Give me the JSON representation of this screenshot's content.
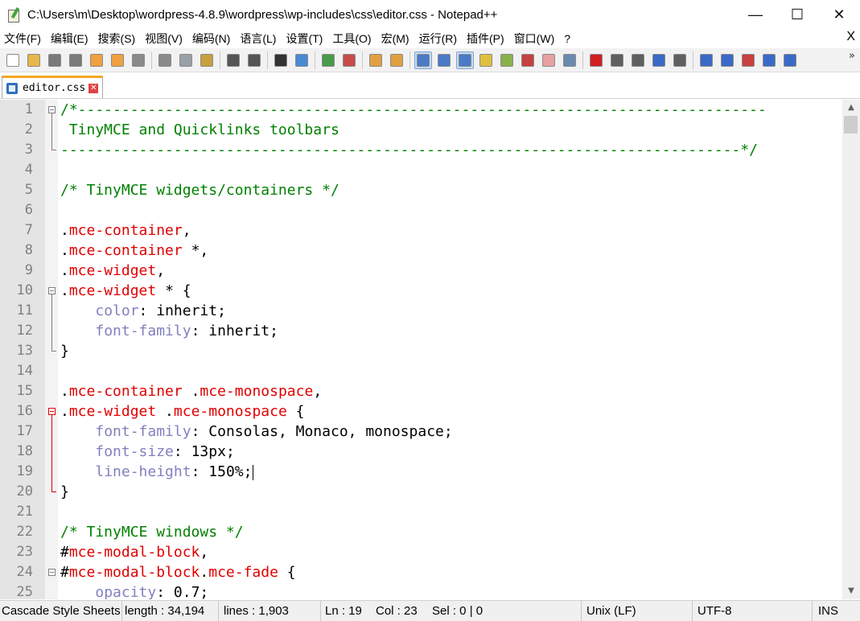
{
  "window": {
    "title": "C:\\Users\\m\\Desktop\\wordpress-4.8.9\\wordpress\\wp-includes\\css\\editor.css - Notepad++",
    "minimize": "—",
    "maximize": "☐",
    "close": "✕"
  },
  "menu": {
    "items": [
      "文件(F)",
      "编辑(E)",
      "搜索(S)",
      "视图(V)",
      "编码(N)",
      "语言(L)",
      "设置(T)",
      "工具(O)",
      "宏(M)",
      "运行(R)",
      "插件(P)",
      "窗口(W)",
      "?"
    ],
    "close": "X"
  },
  "toolbar": {
    "buttons": [
      {
        "name": "new-file-icon",
        "color": "#ffffff"
      },
      {
        "name": "open-file-icon",
        "color": "#e8b64a"
      },
      {
        "name": "save-icon",
        "color": "#7a7a7a"
      },
      {
        "name": "save-all-icon",
        "color": "#7a7a7a"
      },
      {
        "name": "close-file-icon",
        "color": "#f0a040"
      },
      {
        "name": "close-all-icon",
        "color": "#f0a040"
      },
      {
        "name": "print-icon",
        "color": "#8a8a8a"
      },
      {
        "name": "sep"
      },
      {
        "name": "cut-icon",
        "color": "#8a8a8a"
      },
      {
        "name": "copy-icon",
        "color": "#9aa0a8"
      },
      {
        "name": "paste-icon",
        "color": "#c8a040"
      },
      {
        "name": "sep"
      },
      {
        "name": "undo-icon",
        "color": "#555555"
      },
      {
        "name": "redo-icon",
        "color": "#555555"
      },
      {
        "name": "sep"
      },
      {
        "name": "find-icon",
        "color": "#333333"
      },
      {
        "name": "replace-icon",
        "color": "#4a8ad4"
      },
      {
        "name": "sep"
      },
      {
        "name": "zoom-in-icon",
        "color": "#4a9a4a"
      },
      {
        "name": "zoom-out-icon",
        "color": "#c84a4a"
      },
      {
        "name": "sep"
      },
      {
        "name": "sync-vertical-icon",
        "color": "#e0a040"
      },
      {
        "name": "sync-horizontal-icon",
        "color": "#e0a040"
      },
      {
        "name": "sep"
      },
      {
        "name": "word-wrap-icon",
        "color": "#4a7ac8",
        "active": true
      },
      {
        "name": "show-all-chars-icon",
        "color": "#4a7ac8"
      },
      {
        "name": "indent-guide-icon",
        "color": "#4a7ac8",
        "active": true
      },
      {
        "name": "user-language-icon",
        "color": "#e0c040"
      },
      {
        "name": "document-map-icon",
        "color": "#8ab04a"
      },
      {
        "name": "function-list-icon",
        "color": "#c84040"
      },
      {
        "name": "folder-workspace-icon",
        "color": "#e8a0a0"
      },
      {
        "name": "monitor-icon",
        "color": "#6a8ab0"
      },
      {
        "name": "sep"
      },
      {
        "name": "record-macro-icon",
        "color": "#d02020"
      },
      {
        "name": "stop-macro-icon",
        "color": "#606060"
      },
      {
        "name": "play-macro-icon",
        "color": "#606060"
      },
      {
        "name": "run-macro-multiple-icon",
        "color": "#3a6ac8"
      },
      {
        "name": "save-macro-icon",
        "color": "#606060"
      },
      {
        "name": "sep"
      },
      {
        "name": "plugin-1-icon",
        "color": "#3a6ac8"
      },
      {
        "name": "plugin-2-icon",
        "color": "#3a6ac8"
      },
      {
        "name": "plugin-3-icon",
        "color": "#c84040"
      },
      {
        "name": "plugin-4-icon",
        "color": "#3a6ac8"
      },
      {
        "name": "plugin-5-icon",
        "color": "#3a6ac8"
      }
    ],
    "more": "»"
  },
  "tab": {
    "label": "editor.css",
    "close": "✕"
  },
  "editor": {
    "lines": [
      {
        "n": "1",
        "segs": [
          [
            "c-comment",
            "/*-------------------------------------------------------------------------------"
          ]
        ]
      },
      {
        "n": "2",
        "segs": [
          [
            "c-comment",
            " TinyMCE and Quicklinks toolbars"
          ]
        ]
      },
      {
        "n": "3",
        "segs": [
          [
            "c-comment",
            "------------------------------------------------------------------------------*/"
          ]
        ]
      },
      {
        "n": "4",
        "segs": []
      },
      {
        "n": "5",
        "segs": [
          [
            "c-comment",
            "/* TinyMCE widgets/containers */"
          ]
        ]
      },
      {
        "n": "6",
        "segs": []
      },
      {
        "n": "7",
        "segs": [
          [
            "c-op",
            "."
          ],
          [
            "c-sel",
            "mce-container"
          ],
          [
            "c-op",
            ","
          ]
        ]
      },
      {
        "n": "8",
        "segs": [
          [
            "c-op",
            "."
          ],
          [
            "c-sel",
            "mce-container"
          ],
          [
            "c-op",
            " *,"
          ]
        ]
      },
      {
        "n": "9",
        "segs": [
          [
            "c-op",
            "."
          ],
          [
            "c-sel",
            "mce-widget"
          ],
          [
            "c-op",
            ","
          ]
        ]
      },
      {
        "n": "10",
        "segs": [
          [
            "c-op",
            "."
          ],
          [
            "c-sel",
            "mce-widget"
          ],
          [
            "c-op",
            " * {"
          ]
        ]
      },
      {
        "n": "11",
        "segs": [
          [
            "c-op",
            "    "
          ],
          [
            "c-prop",
            "color"
          ],
          [
            "c-op",
            ": "
          ],
          [
            "c-val",
            "inherit"
          ],
          [
            "c-op",
            ";"
          ]
        ]
      },
      {
        "n": "12",
        "segs": [
          [
            "c-op",
            "    "
          ],
          [
            "c-prop",
            "font-family"
          ],
          [
            "c-op",
            ": "
          ],
          [
            "c-val",
            "inherit"
          ],
          [
            "c-op",
            ";"
          ]
        ]
      },
      {
        "n": "13",
        "segs": [
          [
            "c-op",
            "}"
          ]
        ]
      },
      {
        "n": "14",
        "segs": []
      },
      {
        "n": "15",
        "segs": [
          [
            "c-op",
            "."
          ],
          [
            "c-sel",
            "mce-container"
          ],
          [
            "c-op",
            " ."
          ],
          [
            "c-sel",
            "mce-monospace"
          ],
          [
            "c-op",
            ","
          ]
        ]
      },
      {
        "n": "16",
        "segs": [
          [
            "c-op",
            "."
          ],
          [
            "c-sel",
            "mce-widget"
          ],
          [
            "c-op",
            " ."
          ],
          [
            "c-sel",
            "mce-monospace"
          ],
          [
            "c-op",
            " {"
          ]
        ]
      },
      {
        "n": "17",
        "segs": [
          [
            "c-op",
            "    "
          ],
          [
            "c-prop",
            "font-family"
          ],
          [
            "c-op",
            ": "
          ],
          [
            "c-val",
            "Consolas, Monaco, monospace"
          ],
          [
            "c-op",
            ";"
          ]
        ]
      },
      {
        "n": "18",
        "segs": [
          [
            "c-op",
            "    "
          ],
          [
            "c-prop",
            "font-size"
          ],
          [
            "c-op",
            ": "
          ],
          [
            "c-val",
            "13px"
          ],
          [
            "c-op",
            ";"
          ]
        ]
      },
      {
        "n": "19",
        "segs": [
          [
            "c-op",
            "    "
          ],
          [
            "c-prop",
            "line-height"
          ],
          [
            "c-op",
            ": "
          ],
          [
            "c-val",
            "150%"
          ],
          [
            "c-op",
            ";"
          ]
        ],
        "caret": true
      },
      {
        "n": "20",
        "segs": [
          [
            "c-op",
            "}"
          ]
        ]
      },
      {
        "n": "21",
        "segs": []
      },
      {
        "n": "22",
        "segs": [
          [
            "c-comment",
            "/* TinyMCE windows */"
          ]
        ]
      },
      {
        "n": "23",
        "segs": [
          [
            "c-op",
            "#"
          ],
          [
            "c-sel",
            "mce-modal-block"
          ],
          [
            "c-op",
            ","
          ]
        ]
      },
      {
        "n": "24",
        "segs": [
          [
            "c-op",
            "#"
          ],
          [
            "c-sel",
            "mce-modal-block"
          ],
          [
            "c-op",
            "."
          ],
          [
            "c-sel",
            "mce-fade"
          ],
          [
            "c-op",
            " {"
          ]
        ]
      },
      {
        "n": "25",
        "segs": [
          [
            "c-op",
            "    "
          ],
          [
            "c-prop",
            "opacity"
          ],
          [
            "c-op",
            ": "
          ],
          [
            "c-val",
            "0.7"
          ],
          [
            "c-op",
            ";"
          ]
        ]
      }
    ]
  },
  "scrollbar": {
    "up": "▲",
    "down": "▼"
  },
  "status": {
    "language": "Cascade Style Sheets",
    "length": "length : 34,194",
    "lines": "lines : 1,903",
    "ln": "Ln : 19",
    "col": "Col : 23",
    "sel": "Sel : 0 | 0",
    "eol": "Unix (LF)",
    "encoding": "UTF-8",
    "mode": "INS"
  }
}
